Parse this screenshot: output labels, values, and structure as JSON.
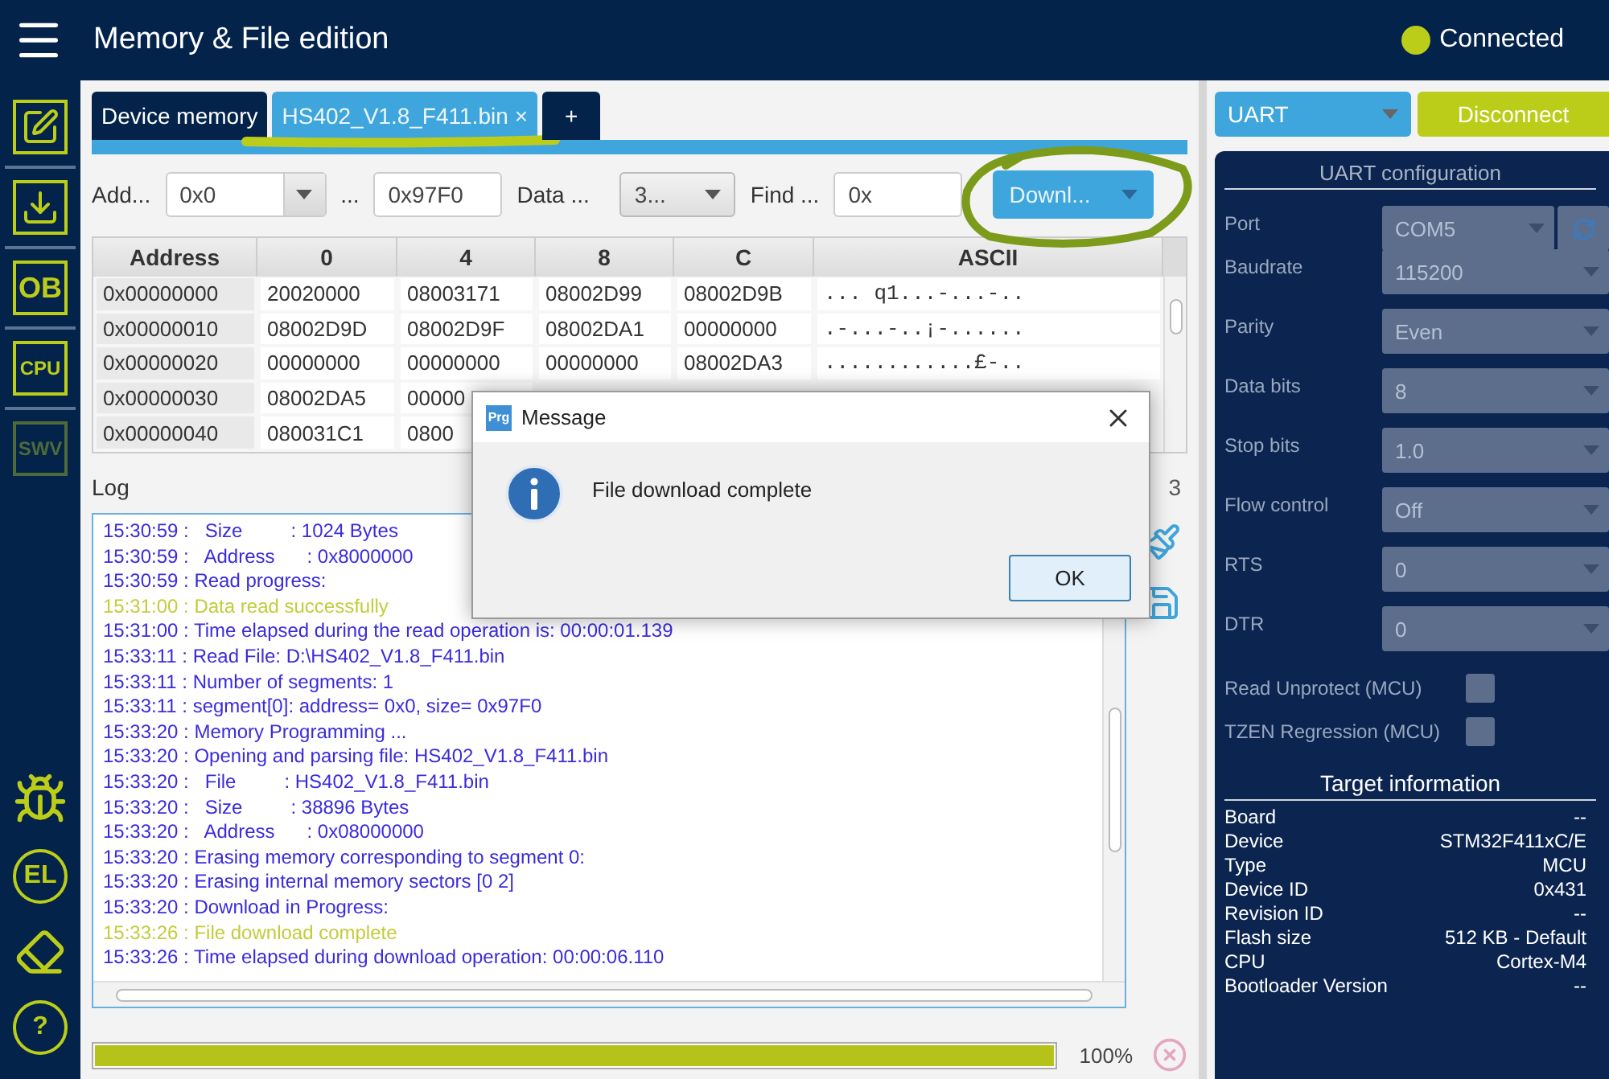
{
  "header": {
    "title": "Memory & File edition",
    "status": "Connected",
    "connected": true
  },
  "sidebar": {
    "top": [
      {
        "kind": "edit",
        "disabled": false
      },
      {
        "kind": "download",
        "disabled": false
      },
      {
        "kind": "text",
        "label": "OB",
        "disabled": false
      },
      {
        "kind": "text",
        "label": "CPU",
        "disabled": false
      },
      {
        "kind": "text",
        "label": "SWV",
        "disabled": true
      }
    ],
    "bottom": [
      {
        "kind": "bug"
      },
      {
        "kind": "circle-text",
        "label": "EL"
      },
      {
        "kind": "eraser"
      },
      {
        "kind": "circle-text",
        "label": "?"
      }
    ]
  },
  "tabs": [
    {
      "label": "Device memory",
      "selected": false
    },
    {
      "label": "HS402_V1.8_F411.bin",
      "selected": true,
      "close": "×",
      "underlined": true
    },
    {
      "label": "+",
      "selected": false
    }
  ],
  "toolbar": [
    {
      "kind": "label",
      "text": "Add..."
    },
    {
      "kind": "combo",
      "value": "0x0"
    },
    {
      "kind": "label",
      "text": "..."
    },
    {
      "kind": "field",
      "value": "0x97F0"
    },
    {
      "kind": "label",
      "text": "Data ..."
    },
    {
      "kind": "dropdown",
      "value": "3..."
    },
    {
      "kind": "label",
      "text": "Find ..."
    },
    {
      "kind": "field",
      "value": "0x"
    },
    {
      "kind": "action",
      "value": "Downl...",
      "circled": true
    }
  ],
  "table": {
    "columns": [
      "Address",
      "0",
      "4",
      "8",
      "C",
      "ASCII"
    ],
    "rows": [
      [
        "0x00000000",
        "20020000",
        "08003171",
        "08002D99",
        "08002D9B",
        "... q1...-...-.."
      ],
      [
        "0x00000010",
        "08002D9D",
        "08002D9F",
        "08002DA1",
        "00000000",
        ".-...-..¡-......"
      ],
      [
        "0x00000020",
        "00000000",
        "00000000",
        "00000000",
        "08002DA3",
        "............£-.."
      ],
      [
        "0x00000030",
        "08002DA5",
        "00000"
      ],
      [
        "0x00000040",
        "080031C1",
        "0800"
      ]
    ]
  },
  "log": {
    "title": "Log",
    "level_fragment": "3",
    "lines": [
      {
        "text": "15:30:59 :   Size         : 1024 Bytes",
        "kind": "info"
      },
      {
        "text": "15:30:59 :   Address      : 0x8000000",
        "kind": "info"
      },
      {
        "text": "15:30:59 : Read progress:",
        "kind": "info"
      },
      {
        "text": "15:31:00 : Data read successfully",
        "kind": "success"
      },
      {
        "text": "15:31:00 : Time elapsed during the read operation is: 00:00:01.139",
        "kind": "info"
      },
      {
        "text": "15:33:11 : Read File: D:\\HS402_V1.8_F411.bin",
        "kind": "info"
      },
      {
        "text": "15:33:11 : Number of segments: 1",
        "kind": "info"
      },
      {
        "text": "15:33:11 : segment[0]: address= 0x0, size= 0x97F0",
        "kind": "info"
      },
      {
        "text": "15:33:20 : Memory Programming ...",
        "kind": "info"
      },
      {
        "text": "15:33:20 : Opening and parsing file: HS402_V1.8_F411.bin",
        "kind": "info"
      },
      {
        "text": "15:33:20 :   File         : HS402_V1.8_F411.bin",
        "kind": "info"
      },
      {
        "text": "15:33:20 :   Size         : 38896 Bytes",
        "kind": "info"
      },
      {
        "text": "15:33:20 :   Address      : 0x08000000",
        "kind": "info"
      },
      {
        "text": "15:33:20 : Erasing memory corresponding to segment 0:",
        "kind": "info"
      },
      {
        "text": "15:33:20 : Erasing internal memory sectors [0 2]",
        "kind": "info"
      },
      {
        "text": "15:33:20 : Download in Progress:",
        "kind": "info"
      },
      {
        "text": "15:33:26 : File download complete",
        "kind": "success"
      },
      {
        "text": "15:33:26 : Time elapsed during download operation: 00:00:06.110",
        "kind": "info"
      }
    ]
  },
  "progress": {
    "level": 1,
    "reading": "100%"
  },
  "dialog": {
    "badge": "Prg",
    "title": "Message",
    "message": "File download complete",
    "button": "OK"
  },
  "connection": {
    "interface": "UART",
    "button": "Disconnect"
  },
  "config": {
    "title": "UART configuration",
    "fields": [
      {
        "label": "Port",
        "value": "COM5",
        "disabled": true,
        "refresh": true
      },
      {
        "label": "Baudrate",
        "value": "115200",
        "disabled": true
      },
      {
        "label": "Parity",
        "value": "Even",
        "disabled": true
      },
      {
        "label": "Data bits",
        "value": "8",
        "disabled": true
      },
      {
        "label": "Stop bits",
        "value": "1.0",
        "disabled": true
      },
      {
        "label": "Flow control",
        "value": "Off",
        "disabled": true
      },
      {
        "label": "RTS",
        "value": "0",
        "disabled": true
      },
      {
        "label": "DTR",
        "value": "0",
        "disabled": true
      }
    ],
    "checkboxes": [
      {
        "label": "Read Unprotect (MCU)",
        "checked": false
      },
      {
        "label": "TZEN Regression (MCU)",
        "checked": false
      }
    ]
  },
  "target": {
    "title": "Target information",
    "rows": [
      {
        "key": "Board",
        "value": "--"
      },
      {
        "key": "Device",
        "value": "STM32F411xC/E"
      },
      {
        "key": "Type",
        "value": "MCU"
      },
      {
        "key": "Device ID",
        "value": "0x431"
      },
      {
        "key": "Revision ID",
        "value": "--"
      },
      {
        "key": "Flash size",
        "value": "512 KB - Default"
      },
      {
        "key": "CPU",
        "value": "Cortex-M4"
      },
      {
        "key": "Bootloader Version",
        "value": "--"
      }
    ]
  }
}
